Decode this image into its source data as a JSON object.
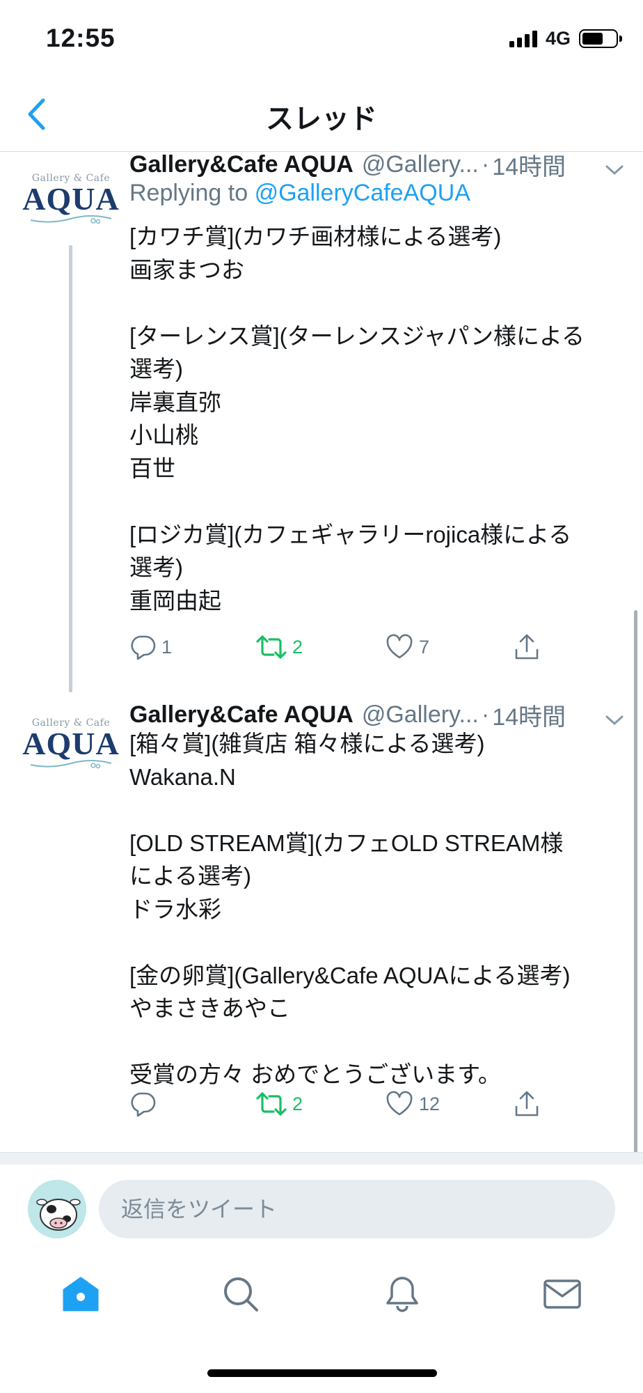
{
  "status_bar": {
    "time": "12:55",
    "network": "4G",
    "battery_level": 0.62
  },
  "header": {
    "title": "スレッド"
  },
  "thread": {
    "tweets": [
      {
        "avatar": {
          "top": "Gallery & Cafe",
          "main": "AQUA"
        },
        "display_name": "Gallery&Cafe AQUA",
        "handle": "@Gallery...",
        "separator": "·",
        "time": "14時間",
        "reply_prefix": "Replying to",
        "reply_to": "@GalleryCafeAQUA",
        "body": [
          "[カワチ賞](カワチ画材様による選考)",
          "画家まつお",
          "",
          "[ターレンス賞](ターレンスジャパン様による",
          "選考)",
          "岸裏直弥",
          "小山桃",
          "百世",
          "",
          "[ロジカ賞](カフェギャラリーrojica様による",
          "選考)",
          "重岡由起"
        ],
        "actions": {
          "replies": "1",
          "retweets": "2",
          "likes": "7"
        }
      },
      {
        "avatar": {
          "top": "Gallery & Cafe",
          "main": "AQUA"
        },
        "display_name": "Gallery&Cafe AQUA",
        "handle": "@Gallery...",
        "separator": "·",
        "time": "14時間",
        "body": [
          "[箱々賞](雑貨店 箱々様による選考)",
          "Wakana.N",
          "",
          "[OLD STREAM賞](カフェOLD STREAM様",
          "による選考)",
          "ドラ水彩",
          "",
          "[金の卵賞](Gallery&Cafe AQUAによる選考)",
          "やまさきあやこ",
          "",
          "受賞の方々 おめでとうございます。"
        ],
        "actions": {
          "replies": "",
          "retweets": "2",
          "likes": "12"
        }
      }
    ]
  },
  "composer": {
    "placeholder": "返信をツイート"
  },
  "tab_bar": {
    "items": [
      "home-icon",
      "search-icon",
      "notifications-icon",
      "messages-icon"
    ],
    "active": "home-icon"
  },
  "colors": {
    "accent": "#1da1f2",
    "retweet": "#17bf63",
    "muted": "#657786",
    "text": "#14171a",
    "avatar_logo": "#1d3c6e"
  }
}
